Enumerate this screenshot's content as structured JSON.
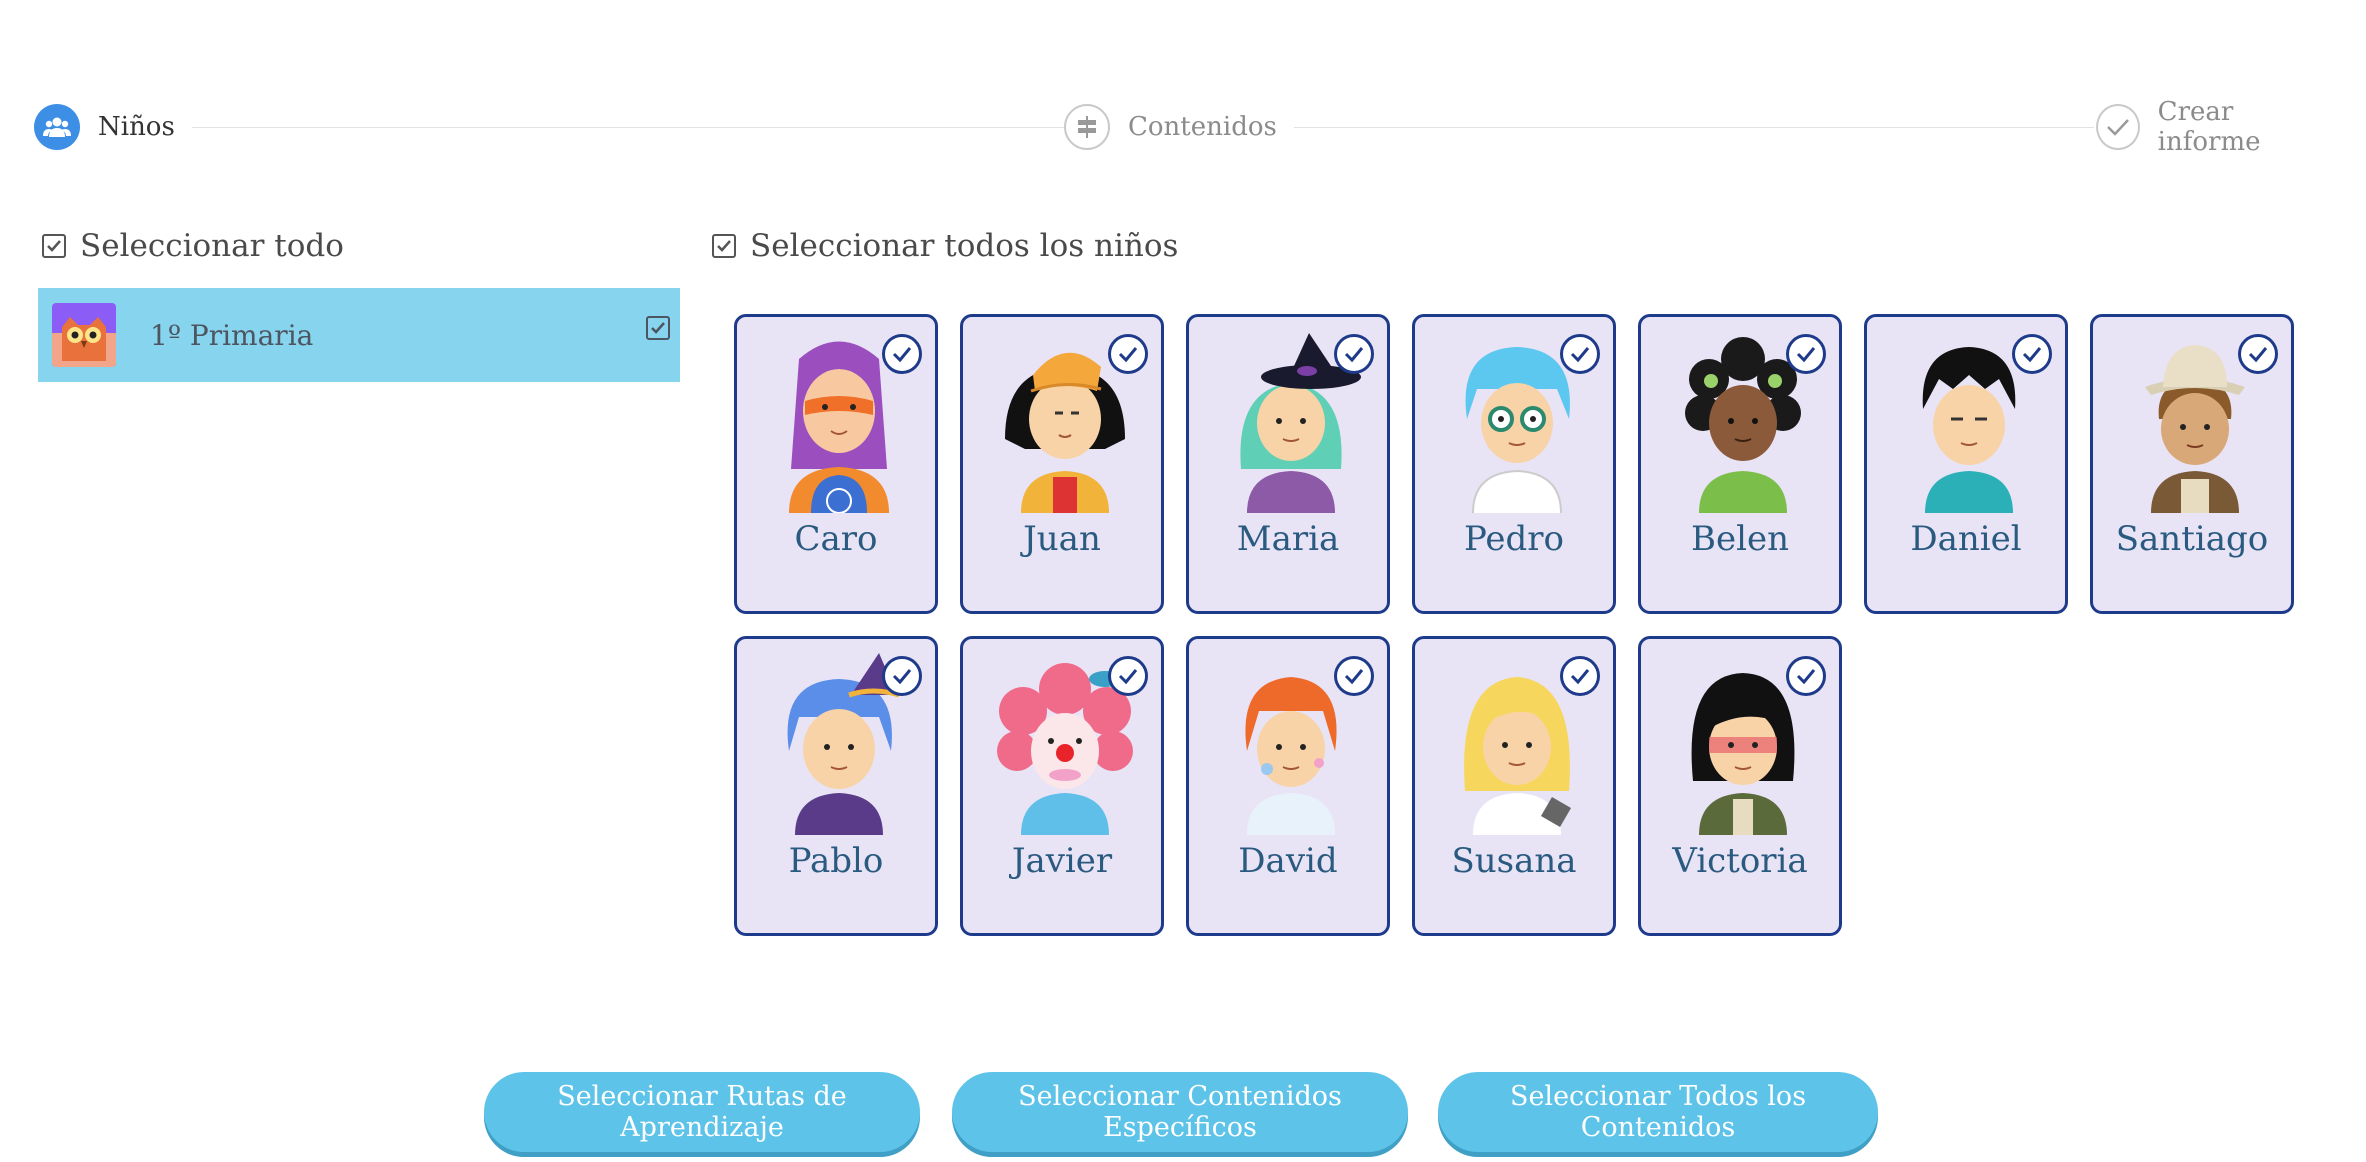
{
  "stepper": {
    "steps": [
      {
        "label": "Niños",
        "state": "active",
        "icon": "people-icon"
      },
      {
        "label": "Contenidos",
        "state": "inactive",
        "icon": "signpost-icon"
      },
      {
        "label": "Crear informe",
        "state": "inactive",
        "icon": "check-icon"
      }
    ]
  },
  "classes_panel": {
    "select_all_label": "Seleccionar todo",
    "select_all_checked": true,
    "items": [
      {
        "name": "1º Primaria",
        "checked": true,
        "avatar": "owl-avatar"
      }
    ]
  },
  "kids_panel": {
    "select_all_label": "Seleccionar todos los niños",
    "select_all_checked": true,
    "kids": [
      {
        "name": "Caro",
        "checked": true
      },
      {
        "name": "Juan",
        "checked": true
      },
      {
        "name": "Maria",
        "checked": true
      },
      {
        "name": "Pedro",
        "checked": true
      },
      {
        "name": "Belen",
        "checked": true
      },
      {
        "name": "Daniel",
        "checked": true
      },
      {
        "name": "Santiago",
        "checked": true
      },
      {
        "name": "Pablo",
        "checked": true
      },
      {
        "name": "Javier",
        "checked": true
      },
      {
        "name": "David",
        "checked": true
      },
      {
        "name": "Susana",
        "checked": true
      },
      {
        "name": "Victoria",
        "checked": true
      }
    ]
  },
  "actions": {
    "learning_paths": "Seleccionar Rutas de Aprendizaje",
    "specific_contents": "Seleccionar Contenidos Específicos",
    "all_contents": "Seleccionar Todos los Contenidos"
  },
  "colors": {
    "accent_blue": "#3d8fe6",
    "selected_row": "#86d4ee",
    "card_border": "#1e3a8a",
    "card_bg": "#e8e4f6",
    "button_bg": "#5ec3e8"
  }
}
